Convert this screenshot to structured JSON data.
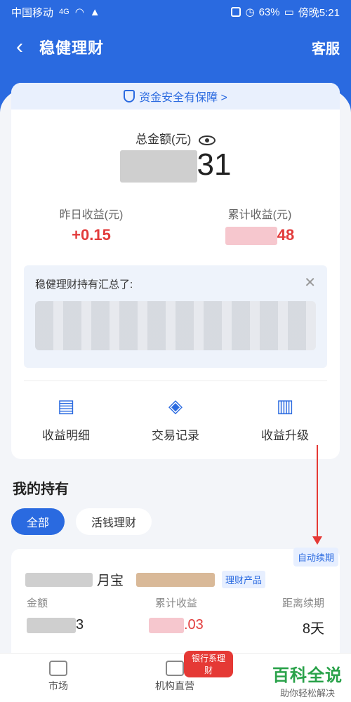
{
  "status_bar": {
    "carrier": "中国移动",
    "signal": "4G",
    "battery": "63%",
    "time": "傍晚5:21"
  },
  "header": {
    "back_icon": "chevron-left-icon",
    "title": "稳健理财",
    "service": "客服"
  },
  "card": {
    "safety_banner": "资金安全有保障 >",
    "total_label": "总金额(元)",
    "total_suffix": "31",
    "yesterday_label": "昨日收益(元)",
    "yesterday_value": "+0.15",
    "cumulative_label": "累计收益(元)",
    "cumulative_suffix": "48",
    "summary_title": "稳健理财持有汇总了:",
    "close_icon": "close-icon",
    "actions": [
      {
        "label": "收益明细",
        "icon": "document-icon"
      },
      {
        "label": "交易记录",
        "icon": "record-icon"
      },
      {
        "label": "收益升级",
        "icon": "chart-icon"
      }
    ]
  },
  "holdings": {
    "title": "我的持有",
    "chips": [
      "全部",
      "活钱理财"
    ],
    "product": {
      "auto_badge": "自动续期",
      "name_suffix": "月宝",
      "tag": "理财产品",
      "amount_label": "金额",
      "amount_suffix": "3",
      "cumulative_label": "累计收益",
      "cumulative_suffix": ".03",
      "renew_label": "距离续期",
      "renew_value": "8天"
    }
  },
  "bottom_nav": {
    "items": [
      "市场",
      "机构直营"
    ],
    "badge": "银行系理财"
  },
  "watermark": {
    "title": "百科全说",
    "subtitle": "助你轻松解决"
  },
  "colors": {
    "primary": "#2a6ae0",
    "red": "#e23b3b",
    "bg": "#f3f5f9"
  }
}
